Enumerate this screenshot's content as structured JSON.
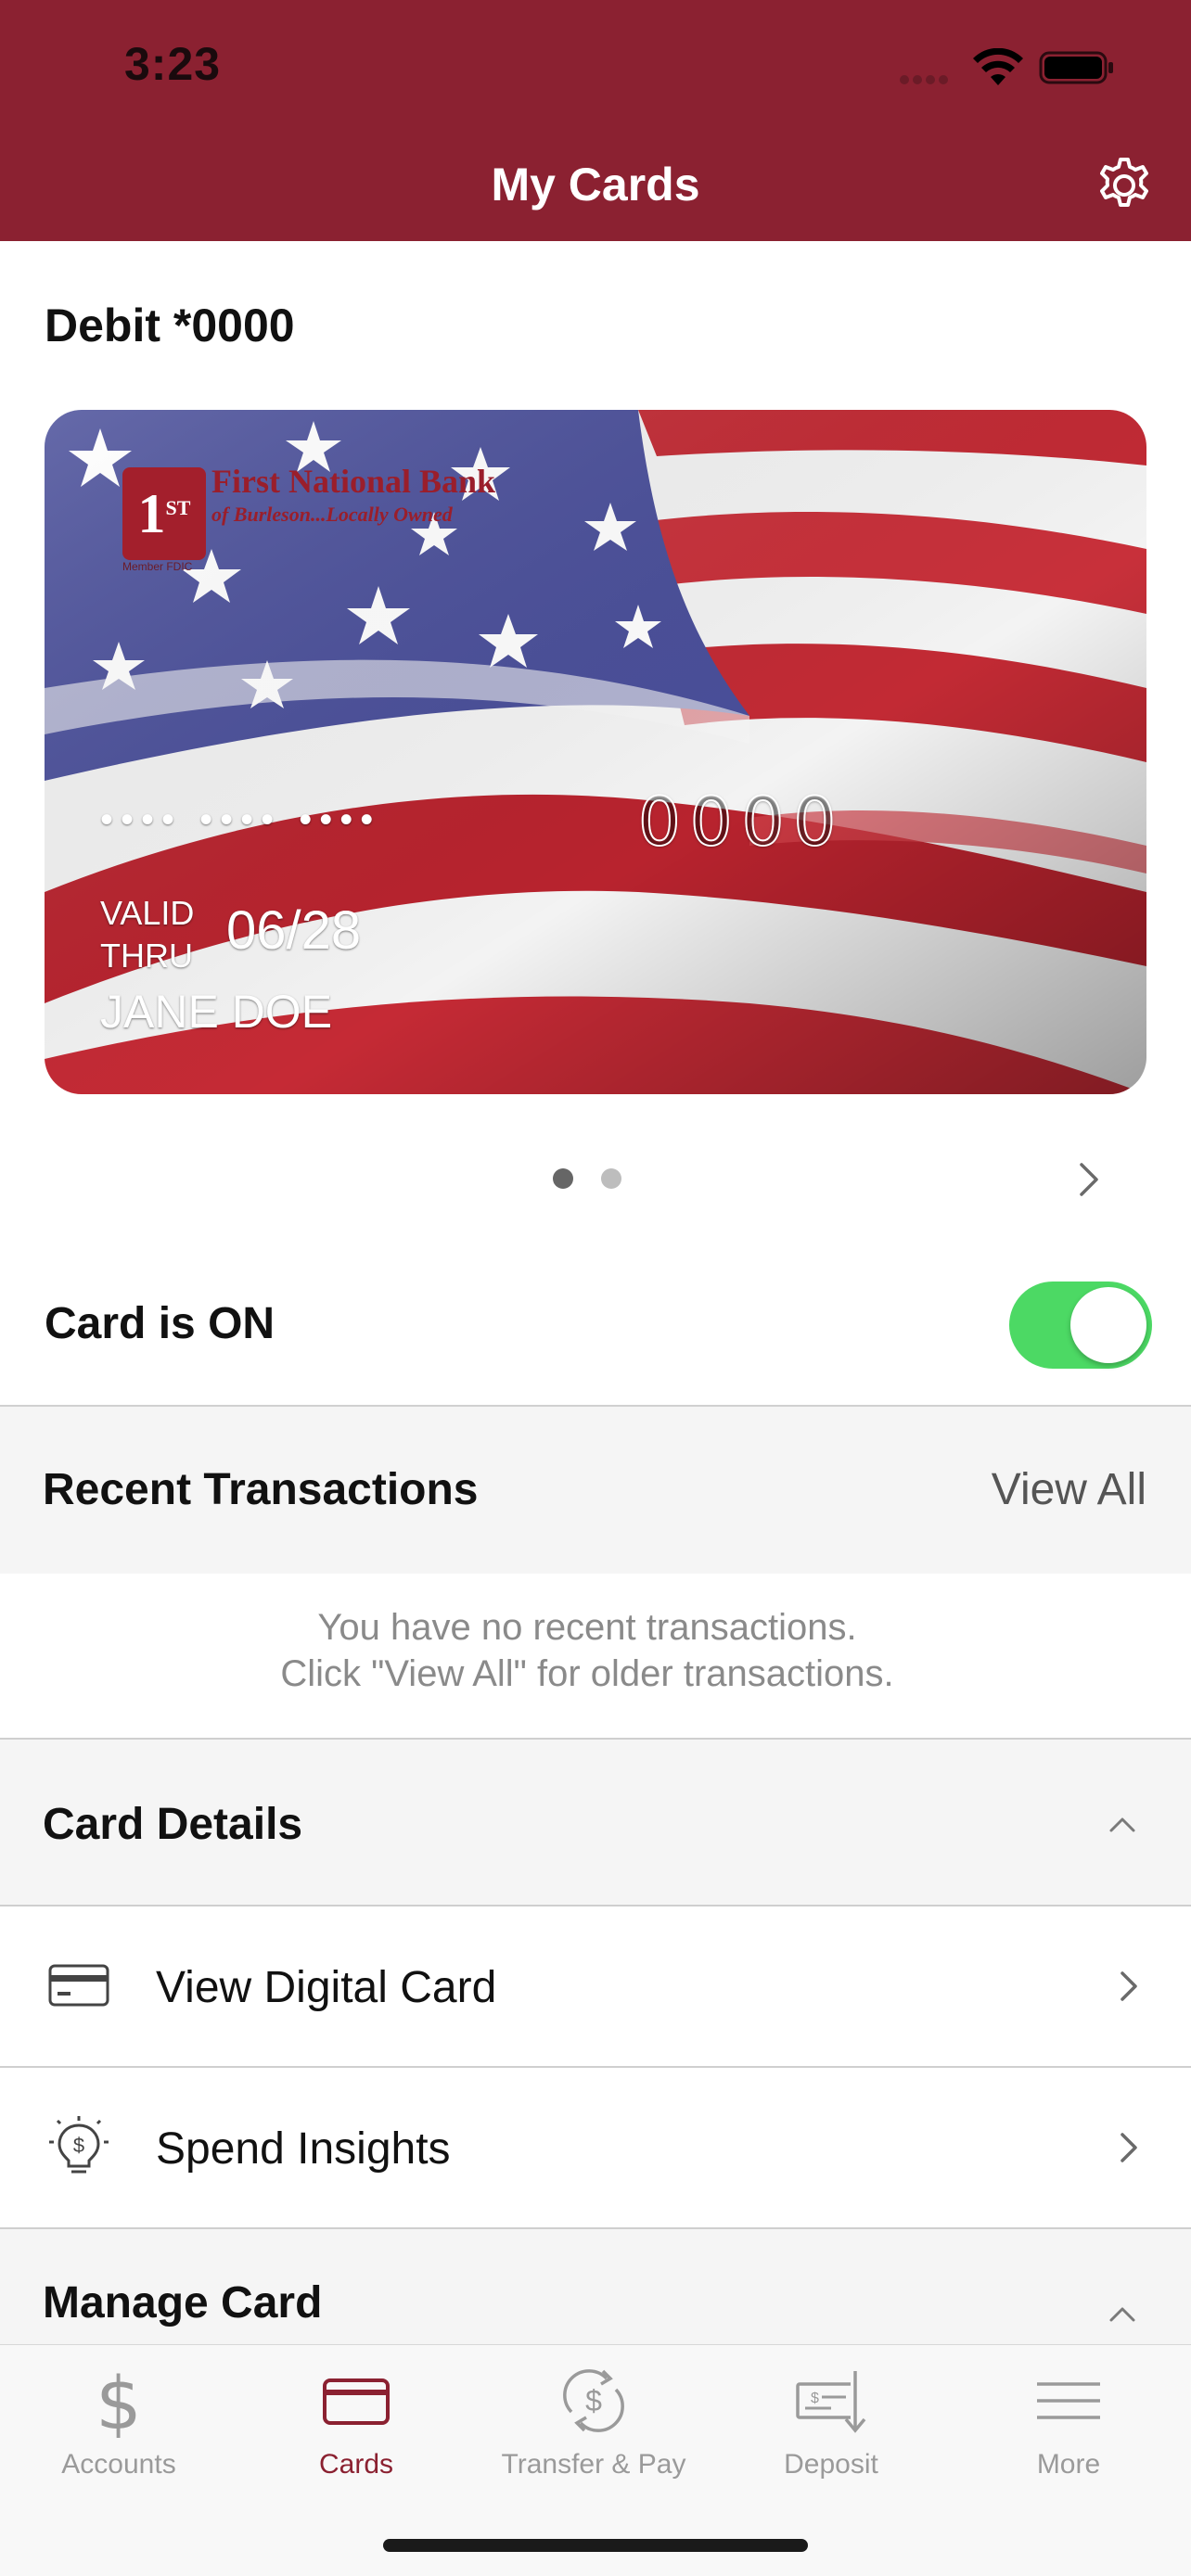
{
  "status_bar": {
    "time": "3:23"
  },
  "header": {
    "title": "My Cards"
  },
  "card": {
    "account_label": "Debit *0000",
    "bank_name": "First National Bank",
    "bank_tagline": "of Burleson...Locally Owned",
    "bank_logo_text": "1",
    "bank_logo_sup": "ST",
    "fdic_text": "Member FDIC",
    "masked_groups": "•••• •••• ••••",
    "last4": "0000",
    "valid_label": "VALID THRU",
    "expiry": "06/28",
    "cardholder": "JANE DOE",
    "page_count": 2,
    "current_page": 1
  },
  "card_toggle": {
    "label": "Card is ON",
    "on": true,
    "color_on": "#4cd964"
  },
  "recent_transactions": {
    "title": "Recent Transactions",
    "view_all": "View All",
    "empty_line1": "You have no recent transactions.",
    "empty_line2": "Click \"View All\" for older transactions."
  },
  "card_details": {
    "title": "Card Details",
    "items": [
      {
        "label": "View Digital Card",
        "icon": "credit-card-icon"
      },
      {
        "label": "Spend Insights",
        "icon": "lightbulb-dollar-icon"
      }
    ]
  },
  "manage_card": {
    "title": "Manage Card"
  },
  "tabbar": {
    "tabs": [
      {
        "label": "Accounts",
        "icon": "dollar-icon",
        "active": false
      },
      {
        "label": "Cards",
        "icon": "card-icon",
        "active": true
      },
      {
        "label": "Transfer & Pay",
        "icon": "transfer-icon",
        "active": false
      },
      {
        "label": "Deposit",
        "icon": "check-deposit-icon",
        "active": false
      },
      {
        "label": "More",
        "icon": "menu-icon",
        "active": false
      }
    ]
  },
  "colors": {
    "brand": "#8b2131",
    "toggle_on": "#4cd964",
    "section_bg": "#f5f5f5"
  }
}
